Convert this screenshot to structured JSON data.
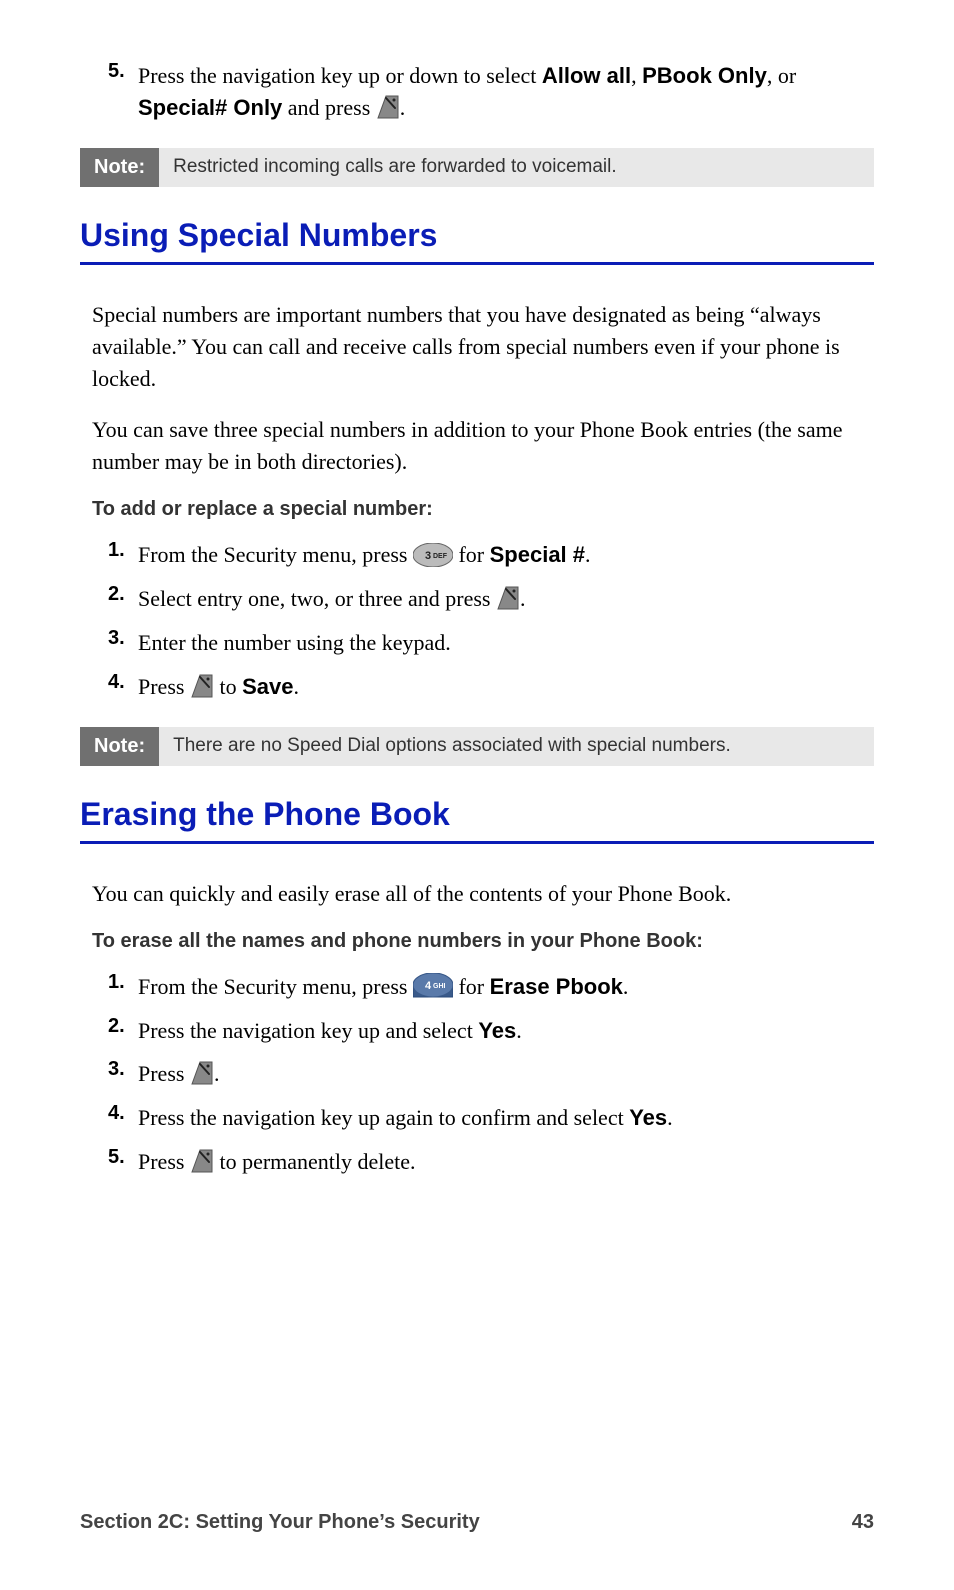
{
  "first_step": {
    "num": "5.",
    "pre": "Press the navigation key up or down to select ",
    "b1": "Allow all",
    "sep1": ", ",
    "b2": "PBook Only",
    "sep2": ", or ",
    "b3": "Special# Only",
    "post": " and press ",
    "dot": "."
  },
  "note1": {
    "label": "Note:",
    "text": "Restricted incoming calls are forwarded to voicemail."
  },
  "h_special": "Using Special Numbers",
  "p_special_1": "Special numbers are important numbers that you have designated as being “always available.” You can call and receive calls from special numbers even if your phone is locked.",
  "p_special_2": "You can save three special numbers in addition to your Phone Book entries (the same number may be in both directories).",
  "sub_special": "To add or replace a special number:",
  "sp_steps": {
    "s1": {
      "num": "1.",
      "pre": "From the Security menu, press ",
      "post": " for ",
      "b": "Special #",
      "dot": "."
    },
    "s2": {
      "num": "2.",
      "pre": "Select entry one, two, or three and press ",
      "dot": "."
    },
    "s3": {
      "num": "3.",
      "txt": "Enter the number using the keypad."
    },
    "s4": {
      "num": "4.",
      "pre": "Press ",
      "post": " to ",
      "b": "Save",
      "dot": "."
    }
  },
  "note2": {
    "label": "Note:",
    "text": "There are no Speed Dial options associated with special numbers."
  },
  "h_erase": "Erasing the Phone Book",
  "p_erase": "You can quickly and easily erase all of the contents of your Phone Book.",
  "sub_erase": "To erase all the names and phone numbers in your Phone Book:",
  "er_steps": {
    "s1": {
      "num": "1.",
      "pre": "From the Security menu, press ",
      "post": " for ",
      "b": "Erase Pbook",
      "dot": "."
    },
    "s2": {
      "num": "2.",
      "pre": "Press the navigation key up and select ",
      "b": "Yes",
      "dot": "."
    },
    "s3": {
      "num": "3.",
      "pre": "Press ",
      "dot": "."
    },
    "s4": {
      "num": "4.",
      "pre": "Press the navigation key up again to confirm and select ",
      "b": "Yes",
      "dot": "."
    },
    "s5": {
      "num": "5.",
      "pre": "Press ",
      "post": " to permanently delete."
    }
  },
  "footer": {
    "section": "Section 2C: Setting Your Phone’s Security",
    "page": "43"
  }
}
